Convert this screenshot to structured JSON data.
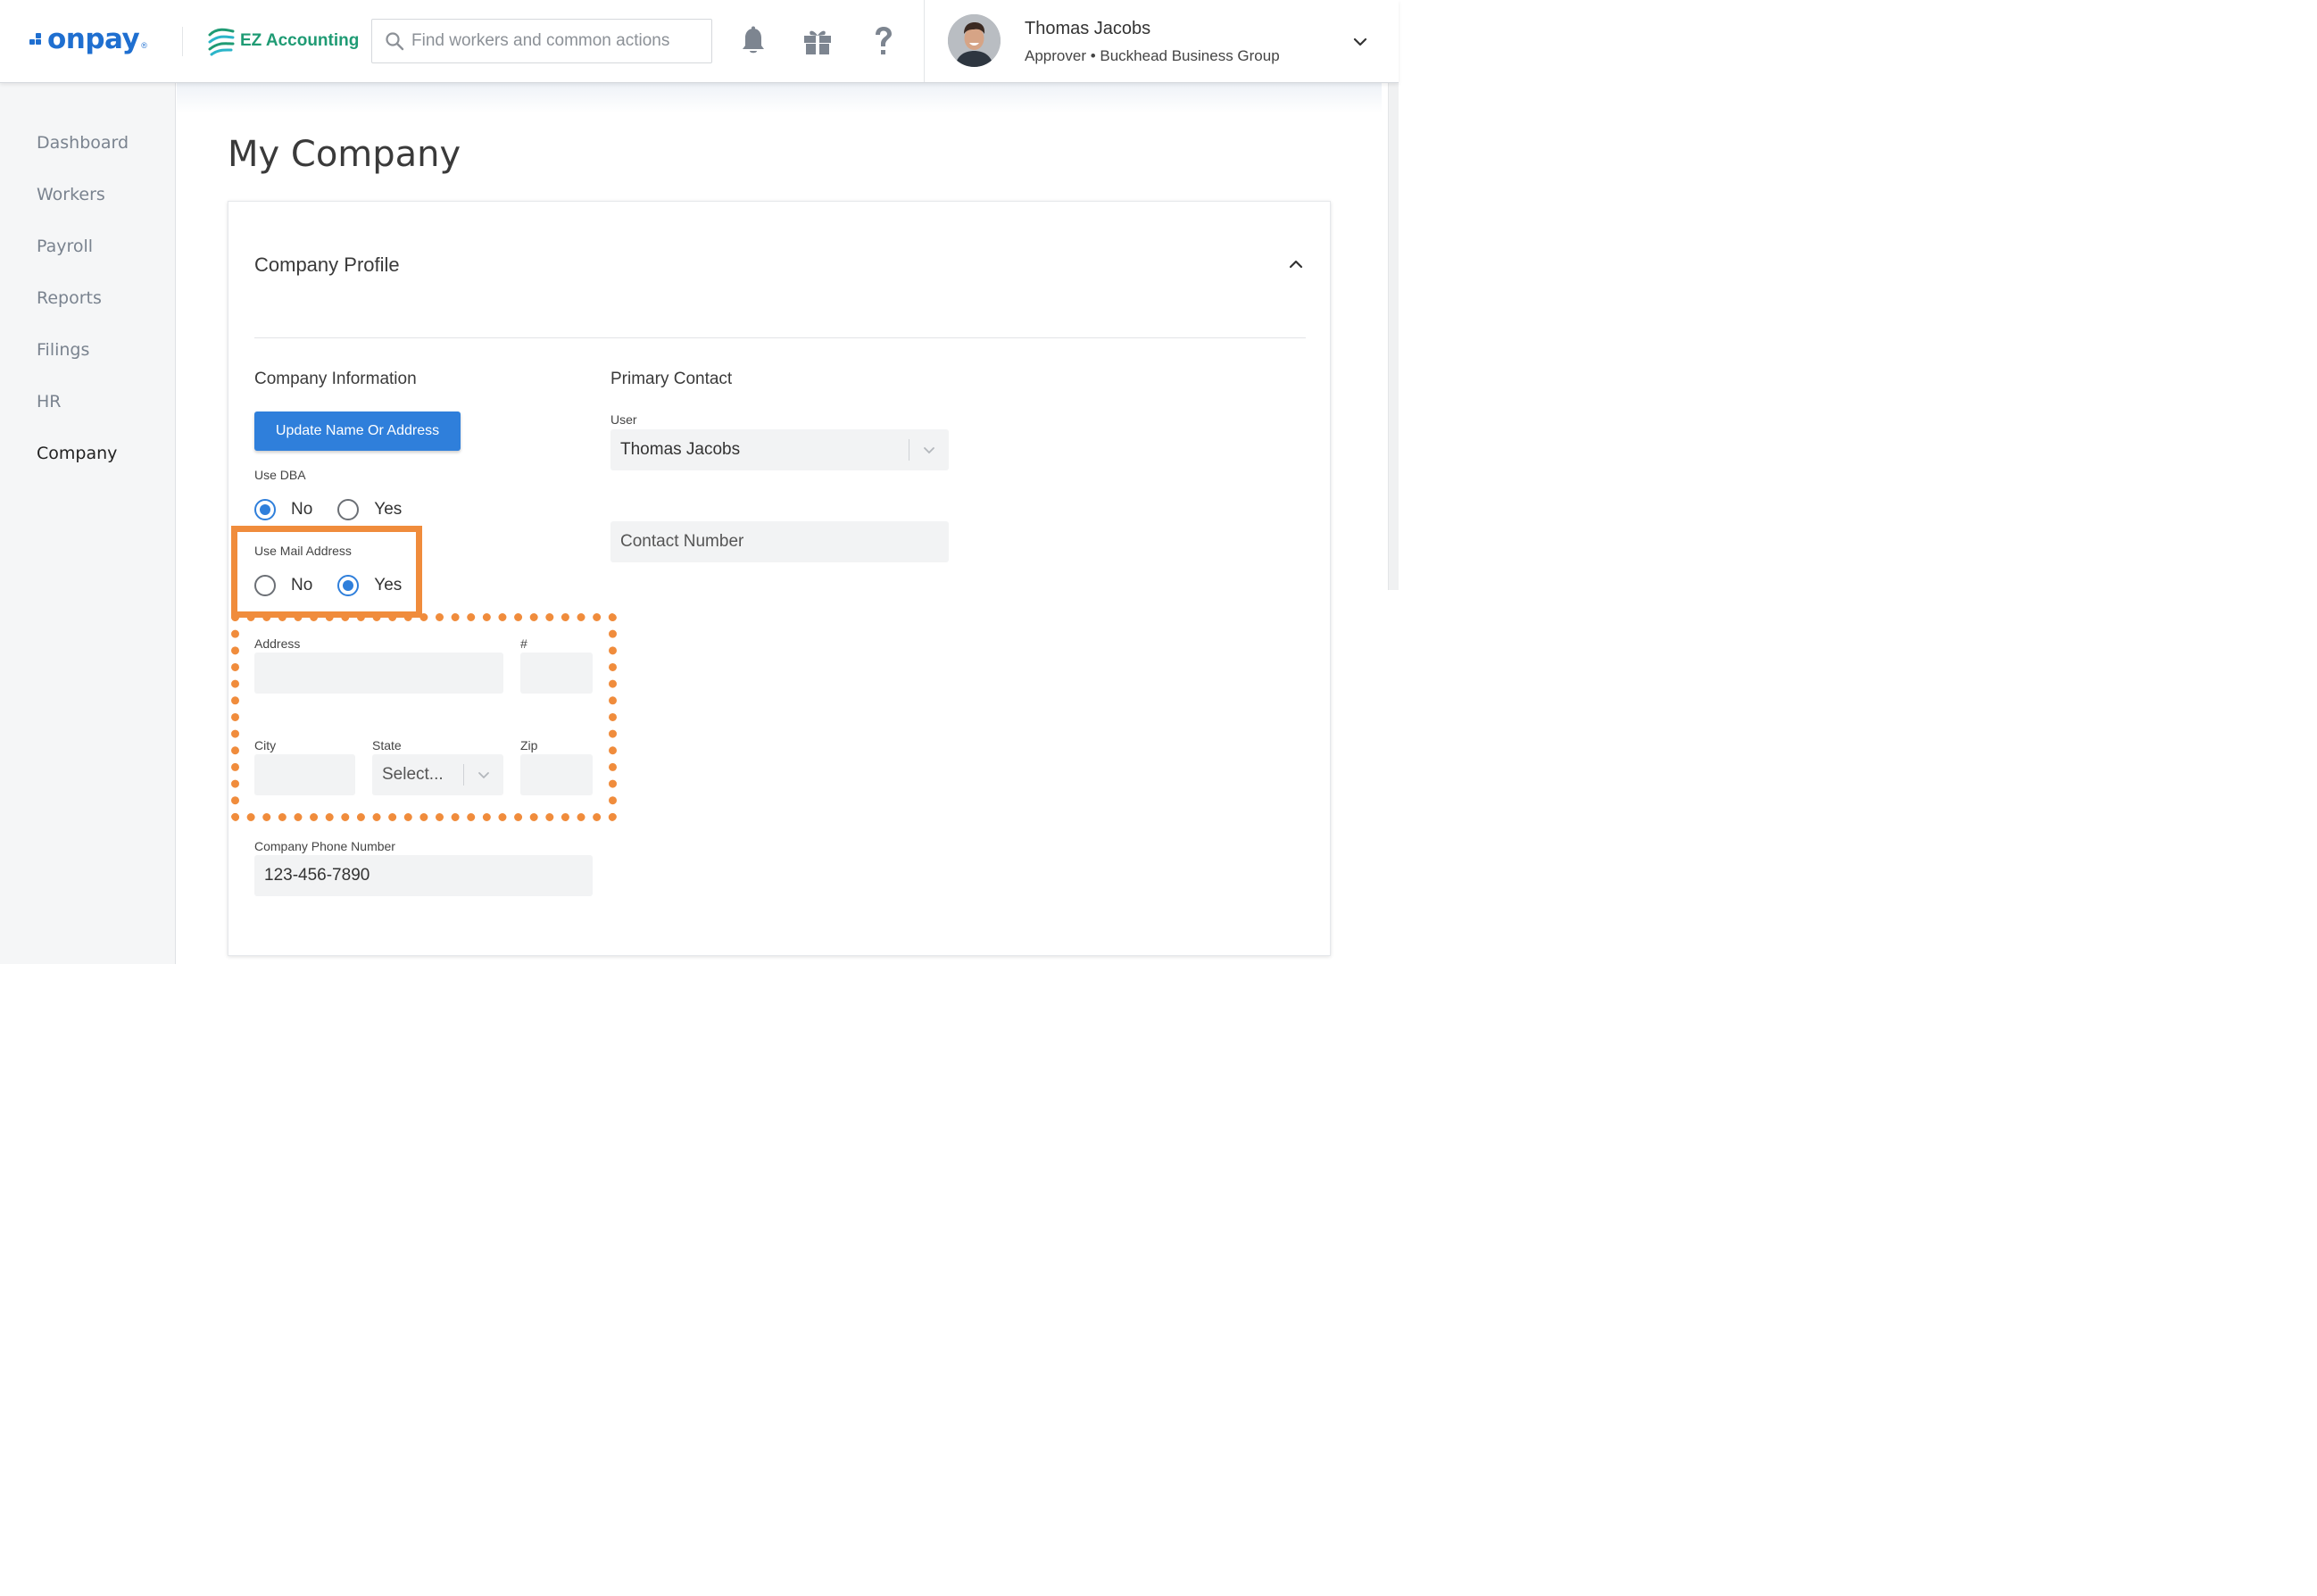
{
  "header": {
    "brand": "onpay",
    "brand_mark": "®",
    "partner": "EZ Accounting",
    "search_placeholder": "Find workers and common actions",
    "user_name": "Thomas Jacobs",
    "user_role": "Approver • Buckhead Business Group",
    "icons": [
      "bell-icon",
      "gift-icon",
      "help-icon",
      "chevron-down-icon"
    ]
  },
  "sidebar": {
    "items": [
      {
        "label": "Dashboard",
        "active": false
      },
      {
        "label": "Workers",
        "active": false
      },
      {
        "label": "Payroll",
        "active": false
      },
      {
        "label": "Reports",
        "active": false
      },
      {
        "label": "Filings",
        "active": false
      },
      {
        "label": "HR",
        "active": false
      },
      {
        "label": "Company",
        "active": true
      }
    ]
  },
  "page": {
    "title": "My Company",
    "card_title": "Company Profile",
    "company_info": {
      "heading": "Company Information",
      "update_button": "Update Name Or Address",
      "use_dba": {
        "label": "Use DBA",
        "options": [
          "No",
          "Yes"
        ],
        "selected": "No"
      },
      "use_mail": {
        "label": "Use Mail Address",
        "options": [
          "No",
          "Yes"
        ],
        "selected": "Yes"
      },
      "address_label": "Address",
      "address_value": "",
      "number_label": "#",
      "number_value": "",
      "city_label": "City",
      "city_value": "",
      "state_label": "State",
      "state_value": "Select...",
      "zip_label": "Zip",
      "zip_value": "",
      "phone_label": "Company Phone Number",
      "phone_value": "123-456-7890"
    },
    "primary_contact": {
      "heading": "Primary Contact",
      "user_label": "User",
      "user_value": "Thomas Jacobs",
      "contact_number_placeholder": "Contact Number"
    }
  },
  "colors": {
    "brand": "#1f6fd0",
    "partner": "#1f9b74",
    "primary_button": "#2f7fdb",
    "highlight": "#f08c3c"
  }
}
